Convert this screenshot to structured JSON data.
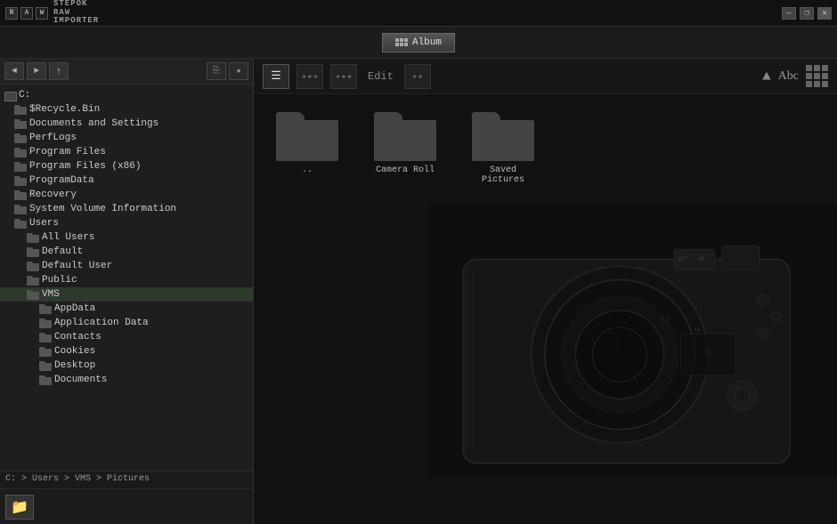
{
  "app": {
    "title": "STEPOK RAW IMPORTER",
    "logo_letters": [
      "R",
      "A",
      "W"
    ],
    "title_lines": [
      "STEPOK",
      "RAW",
      "IMPORTER"
    ]
  },
  "window_controls": {
    "minimize": "—",
    "restore": "❐",
    "close": "✕"
  },
  "toolbar": {
    "album_btn": "Album"
  },
  "nav": {
    "back": "◄",
    "forward": "►",
    "up": "↑"
  },
  "tree": {
    "drive": "C:",
    "items": [
      {
        "label": "$Recycle.Bin",
        "indent": 1
      },
      {
        "label": "Documents and Settings",
        "indent": 1
      },
      {
        "label": "PerfLogs",
        "indent": 1
      },
      {
        "label": "Program Files",
        "indent": 1
      },
      {
        "label": "Program Files (x86)",
        "indent": 1
      },
      {
        "label": "ProgramData",
        "indent": 1
      },
      {
        "label": "Recovery",
        "indent": 1
      },
      {
        "label": "System Volume Information",
        "indent": 1
      },
      {
        "label": "Users",
        "indent": 1
      },
      {
        "label": "All Users",
        "indent": 2
      },
      {
        "label": "Default",
        "indent": 2
      },
      {
        "label": "Default User",
        "indent": 2
      },
      {
        "label": "Public",
        "indent": 2
      },
      {
        "label": "VMS",
        "indent": 2
      },
      {
        "label": "AppData",
        "indent": 3
      },
      {
        "label": "Application Data",
        "indent": 3
      },
      {
        "label": "Contacts",
        "indent": 3
      },
      {
        "label": "Cookies",
        "indent": 3
      },
      {
        "label": "Desktop",
        "indent": 3
      },
      {
        "label": "Documents",
        "indent": 3
      }
    ]
  },
  "path": "C: > Users > VMS > Pictures",
  "folders": [
    {
      "label": ".."
    },
    {
      "label": "Camera Roll"
    },
    {
      "label": "Saved Pictures"
    }
  ],
  "view_tools": {
    "list_icon": "≡",
    "eye_icon": "◉",
    "hand_icon": "✋",
    "edit_label": "Edit",
    "layers_icon": "❋",
    "abc_label": "Abc"
  }
}
